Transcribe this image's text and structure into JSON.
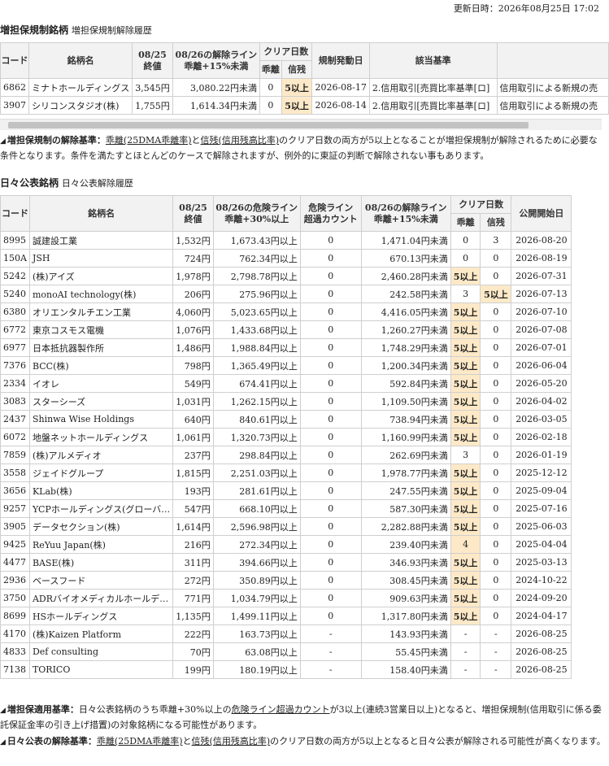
{
  "updated": "更新日時：2026年08月25日 17:02",
  "sec1": {
    "title": "増担保規制銘柄",
    "subtitle": "増担保規制解除履歴",
    "headers": {
      "code": "コード",
      "name": "銘柄名",
      "price_date": "08/25",
      "price": "終値",
      "release_date": "08/26の解除ライン",
      "release_cond": "乖離+15%未満",
      "clear_days": "クリア日数",
      "kairi": "乖離",
      "shinzan": "信残",
      "start": "規制発動日",
      "criteria": "該当基準",
      "extra": ""
    },
    "rows": [
      {
        "code": "6862",
        "name": "ミナトホールディングス",
        "price": "3,545円",
        "line": "3,080.22円未満",
        "kairi": "0",
        "shinzan": "5以上",
        "start": "2026-08-17",
        "criteria": "2.信用取引[売買比率基準[ロ]",
        "extra": "信用取引による新規の売"
      },
      {
        "code": "3907",
        "name": "シリコンスタジオ(株)",
        "price": "1,755円",
        "line": "1,614.34円未満",
        "kairi": "0",
        "shinzan": "5以上",
        "start": "2026-08-14",
        "criteria": "2.信用取引[売買比率基準[ロ]",
        "extra": "信用取引による新規の売"
      }
    ],
    "note": {
      "label": "増担保規制の解除基準：",
      "t1": "乖離(25DMA乖離率)",
      "t2": "と",
      "t3": "信残(信用残高比率)",
      "t4": "のクリア日数の両方が5以上となることが増担保規制が解除されるために必要な条件となります。条件を満たすとほとんどのケースで解除されますが、例外的に東証の判断で解除されない事もあります。"
    }
  },
  "sec2": {
    "title": "日々公表銘柄",
    "subtitle": "日々公表解除履歴",
    "headers": {
      "code": "コード",
      "name": "銘柄名",
      "price_date": "08/25",
      "price": "終値",
      "danger_date": "08/26の危険ライン",
      "danger_cond": "乖離+30%以上",
      "danger_count1": "危険ライン",
      "danger_count2": "超過カウント",
      "release_date": "08/26の解除ライン",
      "release_cond": "乖離+15%未満",
      "clear_days": "クリア日数",
      "kairi": "乖離",
      "shinzan": "信残",
      "start": "公開開始日"
    },
    "rows": [
      {
        "code": "8995",
        "name": "誠建設工業",
        "price": "1,532円",
        "danger": "1,673.43円以上",
        "count": "0",
        "line": "1,471.04円未満",
        "kairi": "0",
        "shinzan": "3",
        "start": "2026-08-20"
      },
      {
        "code": "150A",
        "name": "JSH",
        "price": "724円",
        "danger": "762.34円以上",
        "count": "0",
        "line": "670.13円未満",
        "kairi": "0",
        "shinzan": "0",
        "start": "2026-08-19"
      },
      {
        "code": "5242",
        "name": "(株)アイズ",
        "price": "1,978円",
        "danger": "2,798.78円以上",
        "count": "0",
        "line": "2,460.28円未満",
        "kairi": "5以上",
        "shinzan": "0",
        "start": "2026-07-31"
      },
      {
        "code": "5240",
        "name": "monoAI technology(株)",
        "price": "206円",
        "danger": "275.96円以上",
        "count": "0",
        "line": "242.58円未満",
        "kairi": "3",
        "shinzan": "5以上",
        "start": "2026-07-13"
      },
      {
        "code": "6380",
        "name": "オリエンタルチエン工業",
        "price": "4,060円",
        "danger": "5,023.65円以上",
        "count": "0",
        "line": "4,416.05円未満",
        "kairi": "5以上",
        "shinzan": "0",
        "start": "2026-07-10"
      },
      {
        "code": "6772",
        "name": "東京コスモス電機",
        "price": "1,076円",
        "danger": "1,433.68円以上",
        "count": "0",
        "line": "1,260.27円未満",
        "kairi": "5以上",
        "shinzan": "0",
        "start": "2026-07-08"
      },
      {
        "code": "6977",
        "name": "日本抵抗器製作所",
        "price": "1,486円",
        "danger": "1,988.84円以上",
        "count": "0",
        "line": "1,748.29円未満",
        "kairi": "5以上",
        "shinzan": "0",
        "start": "2026-07-01"
      },
      {
        "code": "7376",
        "name": "BCC(株)",
        "price": "798円",
        "danger": "1,365.49円以上",
        "count": "0",
        "line": "1,200.34円未満",
        "kairi": "5以上",
        "shinzan": "0",
        "start": "2026-06-04"
      },
      {
        "code": "2334",
        "name": "イオレ",
        "price": "549円",
        "danger": "674.41円以上",
        "count": "0",
        "line": "592.84円未満",
        "kairi": "5以上",
        "shinzan": "0",
        "start": "2026-05-20"
      },
      {
        "code": "3083",
        "name": "スターシーズ",
        "price": "1,031円",
        "danger": "1,262.15円以上",
        "count": "0",
        "line": "1,109.50円未満",
        "kairi": "5以上",
        "shinzan": "0",
        "start": "2026-04-02"
      },
      {
        "code": "2437",
        "name": "Shinwa Wise Holdings",
        "price": "640円",
        "danger": "840.61円以上",
        "count": "0",
        "line": "738.94円未満",
        "kairi": "5以上",
        "shinzan": "0",
        "start": "2026-03-05"
      },
      {
        "code": "6072",
        "name": "地盤ネットホールディングス",
        "price": "1,061円",
        "danger": "1,320.73円以上",
        "count": "0",
        "line": "1,160.99円未満",
        "kairi": "5以上",
        "shinzan": "0",
        "start": "2026-02-18"
      },
      {
        "code": "7859",
        "name": "(株)アルメディオ",
        "price": "237円",
        "danger": "298.84円以上",
        "count": "0",
        "line": "262.69円未満",
        "kairi": "3",
        "shinzan": "0",
        "start": "2026-01-19"
      },
      {
        "code": "3558",
        "name": "ジェイドグループ",
        "price": "1,815円",
        "danger": "2,251.03円以上",
        "count": "0",
        "line": "1,978.77円未満",
        "kairi": "5以上",
        "shinzan": "0",
        "start": "2025-12-12"
      },
      {
        "code": "3656",
        "name": "KLab(株)",
        "price": "193円",
        "danger": "281.61円以上",
        "count": "0",
        "line": "247.55円未満",
        "kairi": "5以上",
        "shinzan": "0",
        "start": "2025-09-04"
      },
      {
        "code": "9257",
        "name": "YCPホールディングス(グローバ…",
        "price": "547円",
        "danger": "668.10円以上",
        "count": "0",
        "line": "587.30円未満",
        "kairi": "5以上",
        "shinzan": "0",
        "start": "2025-07-16"
      },
      {
        "code": "3905",
        "name": "データセクション(株)",
        "price": "1,614円",
        "danger": "2,596.98円以上",
        "count": "0",
        "line": "2,282.88円未満",
        "kairi": "5以上",
        "shinzan": "0",
        "start": "2025-06-03"
      },
      {
        "code": "9425",
        "name": "ReYuu Japan(株)",
        "price": "216円",
        "danger": "272.34円以上",
        "count": "0",
        "line": "239.40円未満",
        "kairi": "4",
        "shinzan": "0",
        "start": "2025-04-04"
      },
      {
        "code": "4477",
        "name": "BASE(株)",
        "price": "311円",
        "danger": "394.66円以上",
        "count": "0",
        "line": "346.93円未満",
        "kairi": "5以上",
        "shinzan": "0",
        "start": "2025-03-13"
      },
      {
        "code": "2936",
        "name": "ベースフード",
        "price": "272円",
        "danger": "350.89円以上",
        "count": "0",
        "line": "308.45円未満",
        "kairi": "5以上",
        "shinzan": "0",
        "start": "2024-10-22"
      },
      {
        "code": "3750",
        "name": "ADRバイオメディカルホールデ…",
        "price": "771円",
        "danger": "1,034.79円以上",
        "count": "0",
        "line": "909.63円未満",
        "kairi": "5以上",
        "shinzan": "0",
        "start": "2024-09-20"
      },
      {
        "code": "8699",
        "name": "HSホールディングス",
        "price": "1,135円",
        "danger": "1,499.11円以上",
        "count": "0",
        "line": "1,317.80円未満",
        "kairi": "5以上",
        "shinzan": "0",
        "start": "2024-04-17"
      },
      {
        "code": "4170",
        "name": "(株)Kaizen Platform",
        "price": "222円",
        "danger": "163.73円以上",
        "count": "-",
        "line": "143.93円未満",
        "kairi": "-",
        "shinzan": "-",
        "start": "2026-08-25"
      },
      {
        "code": "4833",
        "name": "Def consulting",
        "price": "70円",
        "danger": "63.08円以上",
        "count": "-",
        "line": "55.45円未満",
        "kairi": "-",
        "shinzan": "-",
        "start": "2026-08-25"
      },
      {
        "code": "7138",
        "name": "TORICO",
        "price": "199円",
        "danger": "180.19円以上",
        "count": "-",
        "line": "158.40円未満",
        "kairi": "-",
        "shinzan": "-",
        "start": "2026-08-25"
      }
    ],
    "note1": {
      "label": "増担保適用基準：",
      "t1": "日々公表銘柄のうち乖離+30%以上の",
      "t2": "危険ライン超過カウント",
      "t3": "が3以上(連続3営業日以上)となると、増担保規制(信用取引に係る委託保証金率の引き上げ措置)の対象銘柄になる可能性があります。"
    },
    "note2": {
      "label": "日々公表の解除基準：",
      "t1": "乖離(25DMA乖離率)",
      "t2": "と",
      "t3": "信残(信用残高比率)",
      "t4": "のクリア日数の両方が5以上となると日々公表が解除される可能性が高くなります。"
    }
  }
}
